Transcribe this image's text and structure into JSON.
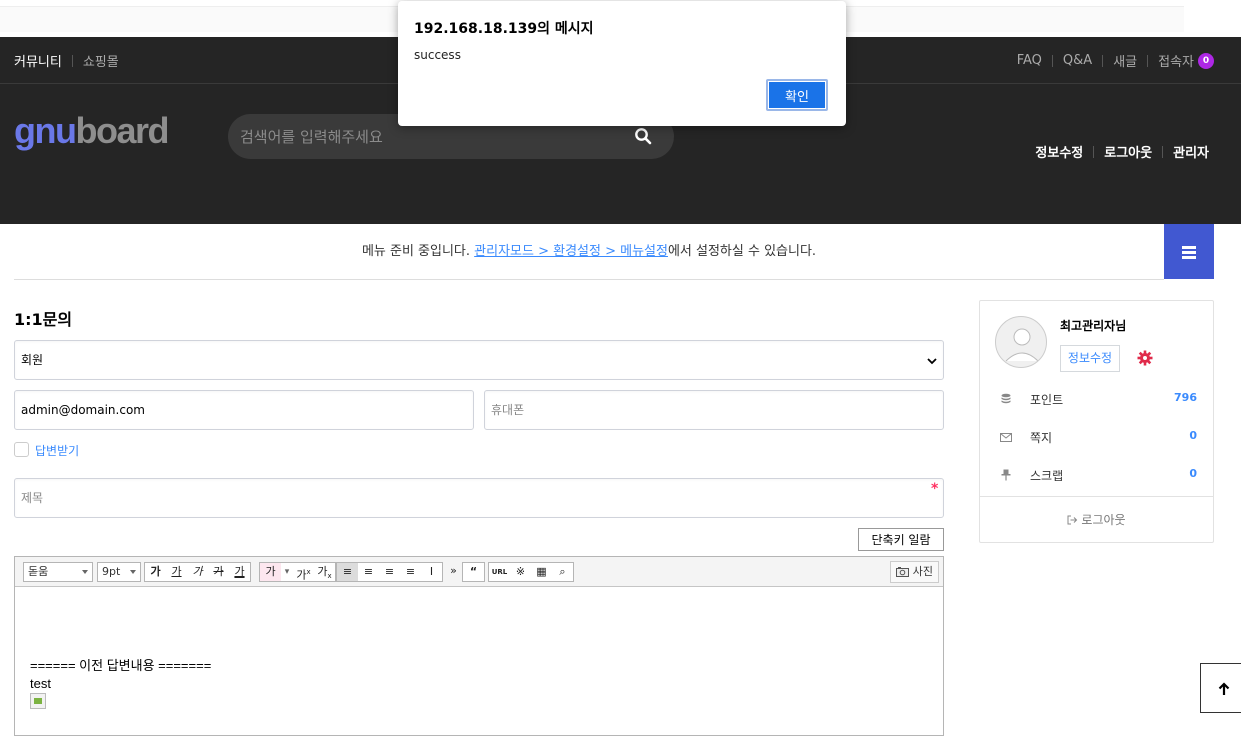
{
  "dialog": {
    "title": "192.168.18.139의 메시지",
    "message": "success",
    "ok_label": "확인"
  },
  "topbar": {
    "left": [
      "커뮤니티",
      "쇼핑몰"
    ],
    "right": [
      "FAQ",
      "Q&A",
      "새글",
      "접속자"
    ],
    "visitor_count": "0"
  },
  "header": {
    "logo_part1": "gnu",
    "logo_part2": "board",
    "search_placeholder": "검색어를 입력해주세요",
    "links": [
      "정보수정",
      "로그아웃",
      "관리자"
    ]
  },
  "menu_note": {
    "prefix": "메뉴 준비 중입니다. ",
    "link": "관리자모드 > 환경설정 > 메뉴설정",
    "suffix": "에서 설정하실 수 있습니다."
  },
  "form": {
    "title": "1:1문의",
    "category_value": "회원",
    "email_value": "admin@domain.com",
    "phone_placeholder": "휴대폰",
    "sms_label": "답변받기",
    "subject_placeholder": "제목",
    "required_mark": "*",
    "shortcut_label": "단축키 일람"
  },
  "editor": {
    "font_value": "돋움",
    "size_value": "9pt",
    "style_buttons": [
      "가",
      "가",
      "가",
      "가",
      "가"
    ],
    "color_buttons": [
      "가",
      "가",
      "가",
      "가"
    ],
    "align_buttons": [
      "≡",
      "≡",
      "≡",
      "≡",
      "I"
    ],
    "more_button": "»",
    "insert_buttons": [
      "“",
      "URL",
      "※",
      "▦",
      "⌕"
    ],
    "photo_label": "사진",
    "body_line1": "====== 이전 답변내용 =======",
    "body_line2": "test"
  },
  "profile": {
    "name": "최고관리자님",
    "edit_label": "정보수정",
    "rows": [
      {
        "label": "포인트",
        "value": "796"
      },
      {
        "label": "쪽지",
        "value": "0"
      },
      {
        "label": "스크랩",
        "value": "0"
      }
    ],
    "logout_label": "로그아웃"
  },
  "colors": {
    "accent": "#4158d1",
    "link": "#3a8afd",
    "badge": "#ae27e6",
    "dark": "#252525"
  }
}
